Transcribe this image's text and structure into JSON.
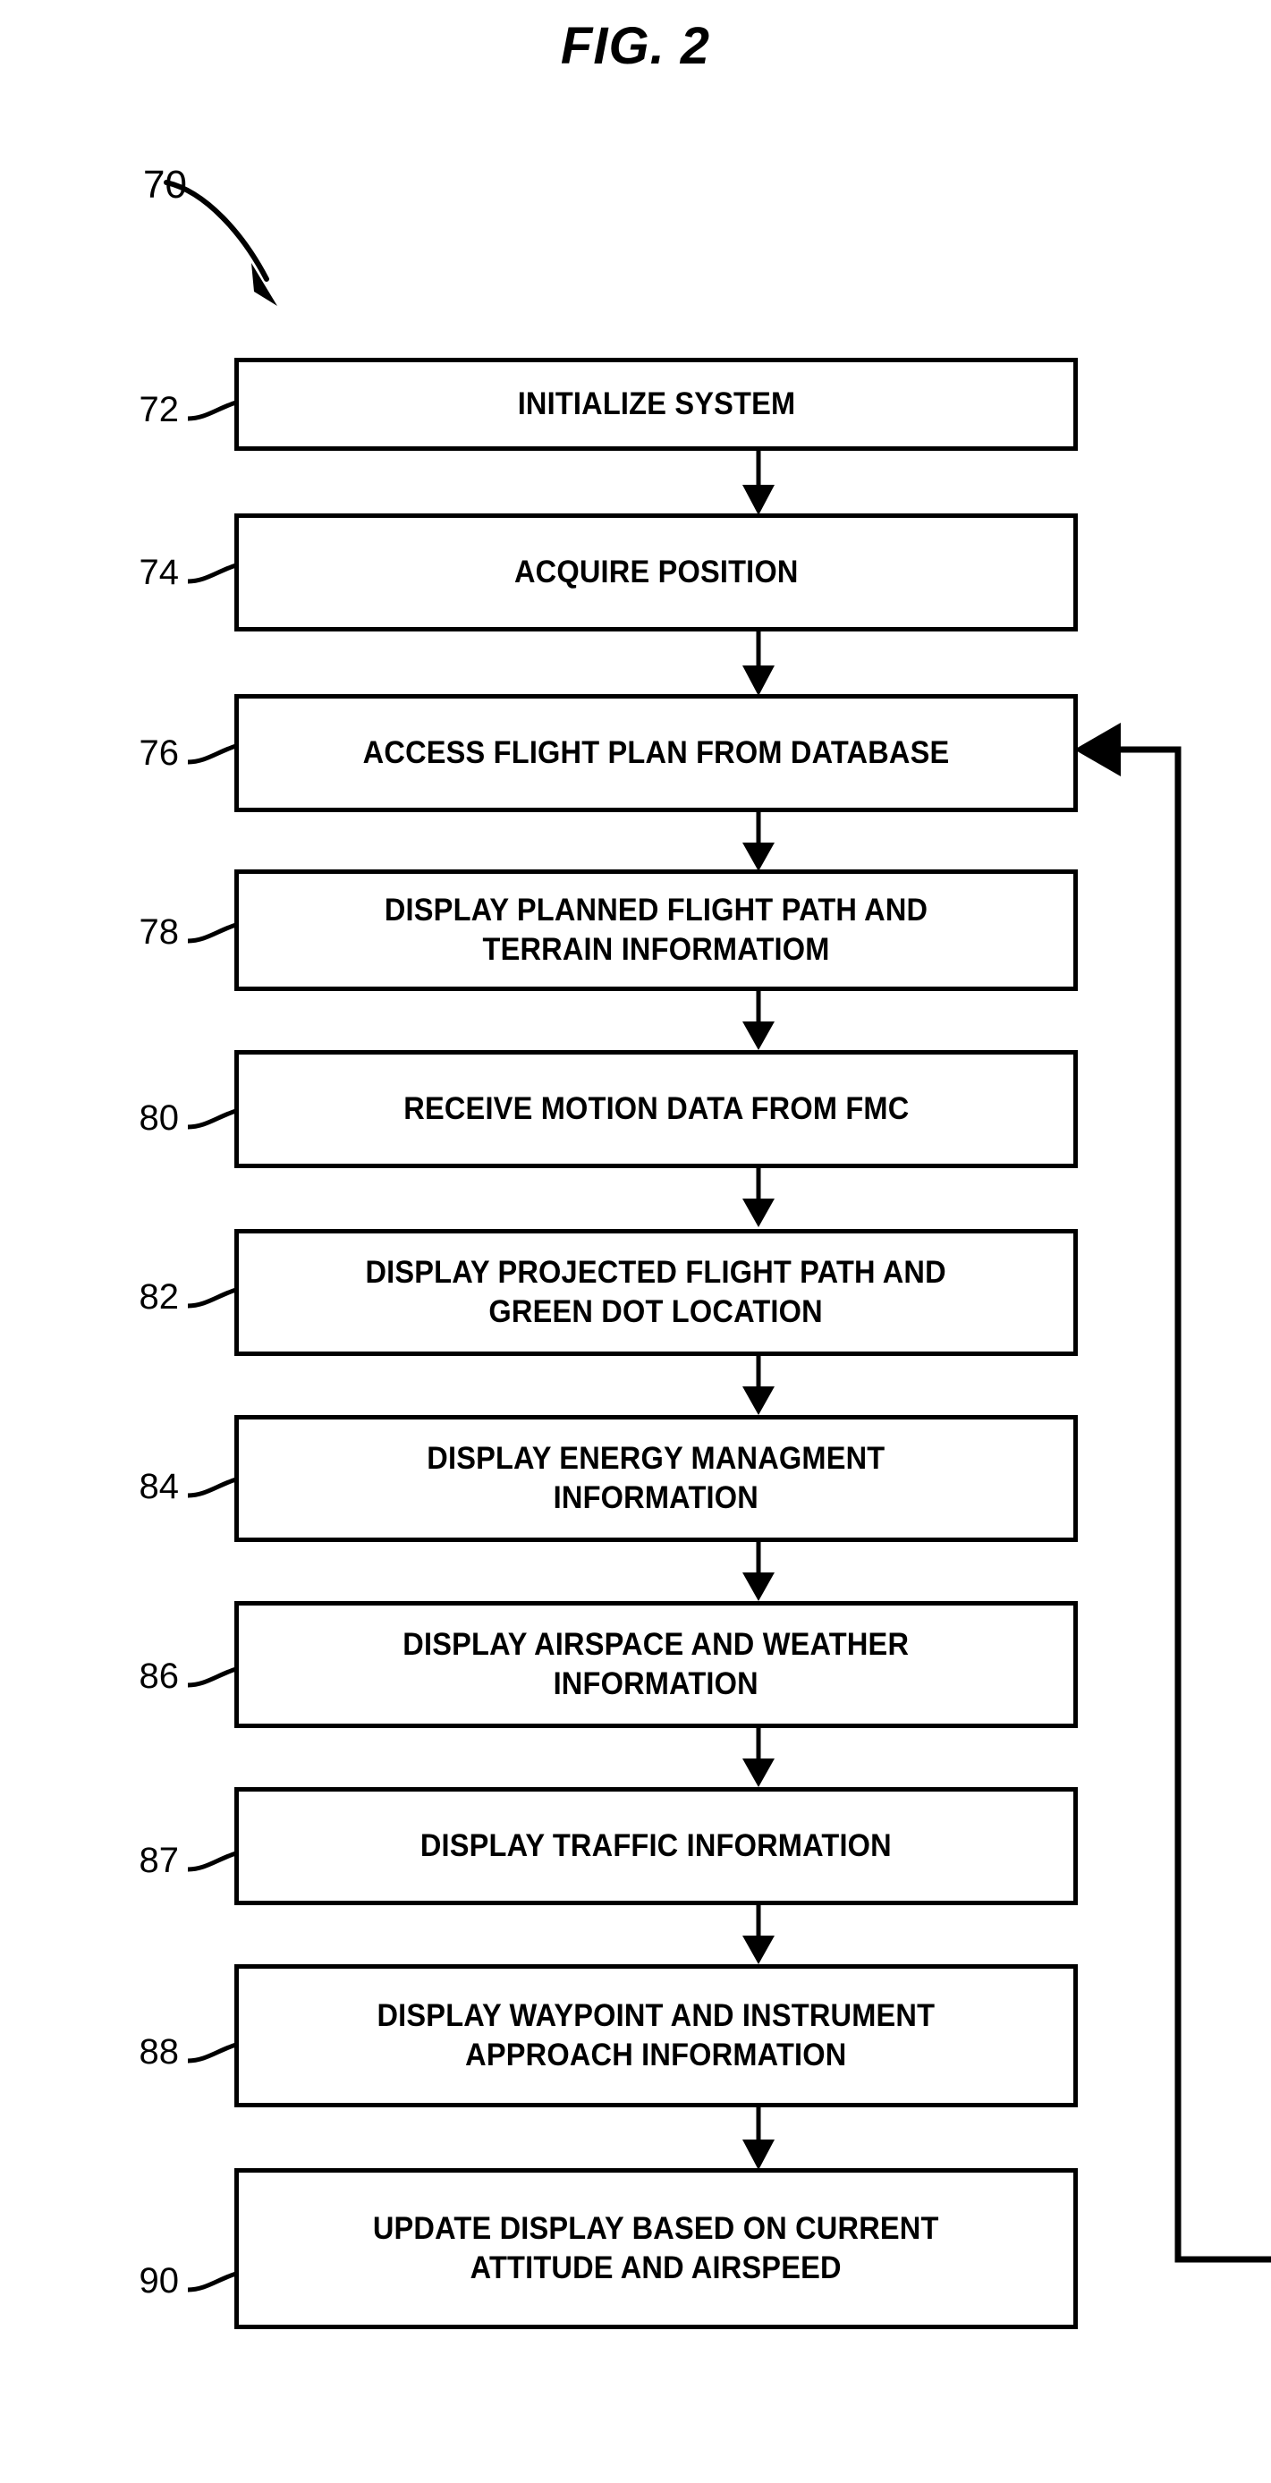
{
  "figure": {
    "title": "FIG. 2",
    "reference_numeral": "70"
  },
  "flowchart": {
    "steps": [
      {
        "ref": "72",
        "label": "INITIALIZE SYSTEM",
        "lines": [
          "INITIALIZE SYSTEM"
        ]
      },
      {
        "ref": "74",
        "label": "ACQUIRE POSITION",
        "lines": [
          "ACQUIRE POSITION"
        ]
      },
      {
        "ref": "76",
        "label": "ACCESS FLIGHT PLAN FROM DATABASE",
        "lines": [
          "ACCESS FLIGHT PLAN FROM DATABASE"
        ]
      },
      {
        "ref": "78",
        "label": "DISPLAY PLANNED FLIGHT PATH AND TERRAIN INFORMATIOM",
        "lines": [
          "DISPLAY PLANNED FLIGHT PATH AND",
          "TERRAIN INFORMATIOM"
        ]
      },
      {
        "ref": "80",
        "label": "RECEIVE MOTION DATA FROM FMC",
        "lines": [
          "RECEIVE MOTION DATA FROM FMC"
        ]
      },
      {
        "ref": "82",
        "label": "DISPLAY PROJECTED FLIGHT PATH AND GREEN DOT LOCATION",
        "lines": [
          "DISPLAY PROJECTED FLIGHT PATH AND",
          "GREEN DOT LOCATION"
        ]
      },
      {
        "ref": "84",
        "label": "DISPLAY ENERGY MANAGMENT INFORMATION",
        "lines": [
          "DISPLAY ENERGY MANAGMENT",
          "INFORMATION"
        ]
      },
      {
        "ref": "86",
        "label": "DISPLAY AIRSPACE AND WEATHER INFORMATION",
        "lines": [
          "DISPLAY AIRSPACE AND WEATHER",
          "INFORMATION"
        ]
      },
      {
        "ref": "87",
        "label": "DISPLAY TRAFFIC INFORMATION",
        "lines": [
          "DISPLAY TRAFFIC INFORMATION"
        ]
      },
      {
        "ref": "88",
        "label": "DISPLAY WAYPOINT AND INSTRUMENT APPROACH INFORMATION",
        "lines": [
          "DISPLAY WAYPOINT AND INSTRUMENT",
          "APPROACH INFORMATION"
        ]
      },
      {
        "ref": "90",
        "label": "UPDATE DISPLAY BASED ON CURRENT ATTITUDE AND AIRSPEED",
        "lines": [
          "UPDATE DISPLAY BASED ON CURRENT",
          "ATTITUDE AND AIRSPEED"
        ]
      }
    ],
    "feedback": {
      "from_ref": "90",
      "to_ref": "76"
    }
  },
  "colors": {
    "ink": "#000000",
    "paper": "#ffffff"
  }
}
